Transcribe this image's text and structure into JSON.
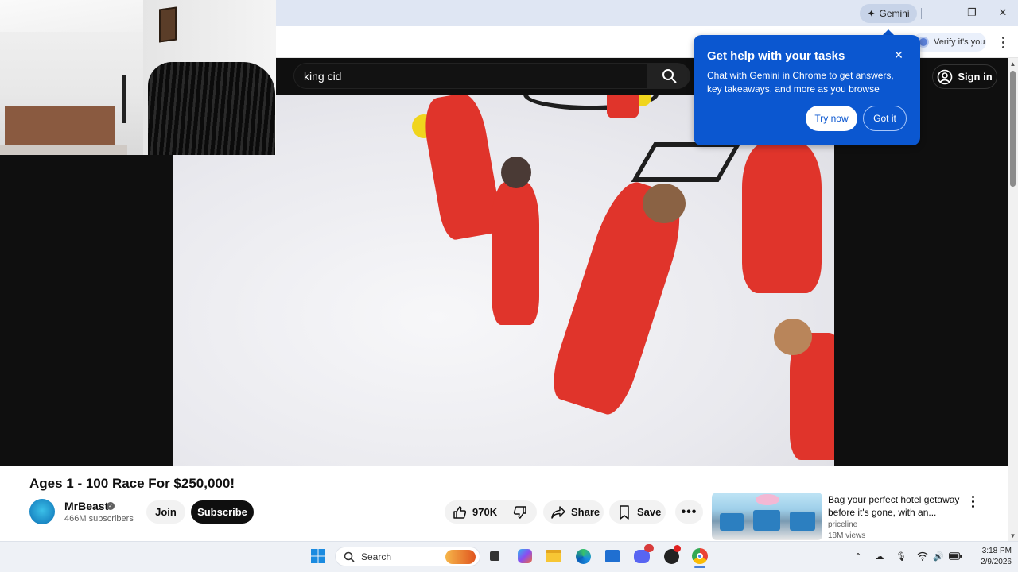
{
  "browser": {
    "gemini_button_label": "Gemini",
    "verify_chip_label": "Verify it's you",
    "window_controls": [
      "minimize-icon",
      "restore-icon",
      "close-icon"
    ]
  },
  "youtube": {
    "search": {
      "value": "king cid"
    },
    "sign_in_label": "Sign in",
    "video": {
      "title": "Ages 1 - 100 Race For $250,000!"
    },
    "channel": {
      "name": "MrBeast",
      "subscribers": "466M subscribers",
      "join_label": "Join",
      "subscribe_label": "Subscribe"
    },
    "actions": {
      "like_count": "970K",
      "share_label": "Share",
      "save_label": "Save"
    },
    "ad": {
      "title": "Bag your perfect hotel getaway before it's gone, with an...",
      "source": "priceline",
      "views": "18M views"
    }
  },
  "popup": {
    "title": "Get help with your tasks",
    "body": "Chat with Gemini in Chrome to get answers, key takeaways, and more as you browse",
    "try_now_label": "Try now",
    "got_it_label": "Got it",
    "color": "#0b57d0"
  },
  "taskbar": {
    "search_label": "Search",
    "time": "3:18 PM",
    "date": "2/9/2026"
  },
  "colors": {
    "youtube_dark": "#0f0f0f",
    "taskbar_bg": "#eef1f6",
    "titlebar_bg": "#dfe6f3"
  }
}
